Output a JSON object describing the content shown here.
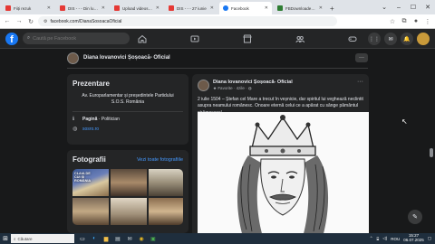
{
  "browser": {
    "tabs": [
      {
        "label": "Fiiți rezuk",
        "color": "#e53935"
      },
      {
        "label": "DIS - - - Din lumin",
        "color": "#e53935"
      },
      {
        "label": "Upload videos at a",
        "color": "#e53935"
      },
      {
        "label": "DIS - - - 27 iunie",
        "color": "#e53935"
      },
      {
        "label": "Facebook",
        "color": "#1877f2"
      },
      {
        "label": "FBDownloader | F",
        "color": "#2e7d32"
      }
    ],
    "new_tab": "+",
    "url": "facebook.com/DianaSosoacaOficial"
  },
  "facebook": {
    "search_placeholder": "Caută pe Facebook",
    "page_name": "Diana Iovanovici Șoșoacă- Oficial"
  },
  "intro": {
    "heading": "Prezentare",
    "bio": "Av. Europarlamentar și președintele Partidului S.O.S. România",
    "category_label": "Pagină",
    "category_value": "Politician",
    "website": "sosro.ro"
  },
  "photos": {
    "heading": "Fotografii",
    "see_all": "Vezi toate fotografiile",
    "caption": "CLAIA DE\nCUI ȘI\nROMÂNIA"
  },
  "post": {
    "author": "Diana Iovanovici Șoșoacă- Oficial",
    "meta": "Favorite · 4zile · ",
    "text": "2 iulie 1504 – Ștefan cel Mare a trecut în veșnicie, dar spiritul lui veghează neclintit asupra neamului românesc. Onoare eternă celui ce a apărat cu sânge pământul strămoșesc!"
  },
  "taskbar": {
    "search_placeholder": "Căutare",
    "language": "ROU",
    "time": "15:27",
    "date": "06.07.2025"
  }
}
